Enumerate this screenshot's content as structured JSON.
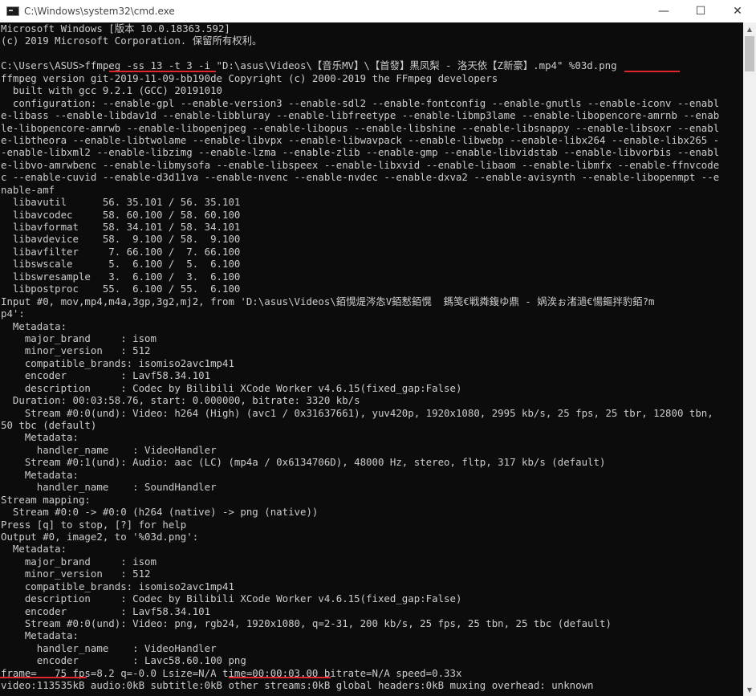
{
  "window": {
    "title": "C:\\Windows\\system32\\cmd.exe",
    "minimize": "—",
    "maximize": "☐",
    "close": "✕"
  },
  "console": {
    "lines": [
      "Microsoft Windows [版本 10.0.18363.592]",
      "(c) 2019 Microsoft Corporation. 保留所有权利。",
      "",
      "C:\\Users\\ASUS>ffmpeg -ss 13 -t 3 -i \"D:\\asus\\Videos\\【音乐MV】\\【首發】黑凤梨 - 洛天依【Z新豪】.mp4\" %03d.png",
      "ffmpeg version git-2019-11-09-bb190de Copyright (c) 2000-2019 the FFmpeg developers",
      "  built with gcc 9.2.1 (GCC) 20191010",
      "  configuration: --enable-gpl --enable-version3 --enable-sdl2 --enable-fontconfig --enable-gnutls --enable-iconv --enabl",
      "e-libass --enable-libdav1d --enable-libbluray --enable-libfreetype --enable-libmp3lame --enable-libopencore-amrnb --enab",
      "le-libopencore-amrwb --enable-libopenjpeg --enable-libopus --enable-libshine --enable-libsnappy --enable-libsoxr --enabl",
      "e-libtheora --enable-libtwolame --enable-libvpx --enable-libwavpack --enable-libwebp --enable-libx264 --enable-libx265 -",
      "-enable-libxml2 --enable-libzimg --enable-lzma --enable-zlib --enable-gmp --enable-libvidstab --enable-libvorbis --enabl",
      "e-libvo-amrwbenc --enable-libmysofa --enable-libspeex --enable-libxvid --enable-libaom --enable-libmfx --enable-ffnvcode",
      "c --enable-cuvid --enable-d3d11va --enable-nvenc --enable-nvdec --enable-dxva2 --enable-avisynth --enable-libopenmpt --e",
      "nable-amf",
      "  libavutil      56. 35.101 / 56. 35.101",
      "  libavcodec     58. 60.100 / 58. 60.100",
      "  libavformat    58. 34.101 / 58. 34.101",
      "  libavdevice    58.  9.100 / 58.  9.100",
      "  libavfilter     7. 66.100 /  7. 66.100",
      "  libswscale      5.  6.100 /  5.  6.100",
      "  libswresample   3.  6.100 /  3.  6.100",
      "  libpostproc    55.  6.100 / 55.  6.100",
      "Input #0, mov,mp4,m4a,3gp,3g2,mj2, from 'D:\\asus\\Videos\\銆愰煶涔怣V銆慭銆愰  鎷笺€戦粦鍑ゆ鼎 - 娲涘ぉ渚濄€愓鏂拌豹銆?m",
      "p4':",
      "  Metadata:",
      "    major_brand     : isom",
      "    minor_version   : 512",
      "    compatible_brands: isomiso2avc1mp41",
      "    encoder         : Lavf58.34.101",
      "    description     : Codec by Bilibili XCode Worker v4.6.15(fixed_gap:False)",
      "  Duration: 00:03:58.76, start: 0.000000, bitrate: 3320 kb/s",
      "    Stream #0:0(und): Video: h264 (High) (avc1 / 0x31637661), yuv420p, 1920x1080, 2995 kb/s, 25 fps, 25 tbr, 12800 tbn,",
      "50 tbc (default)",
      "    Metadata:",
      "      handler_name    : VideoHandler",
      "    Stream #0:1(und): Audio: aac (LC) (mp4a / 0x6134706D), 48000 Hz, stereo, fltp, 317 kb/s (default)",
      "    Metadata:",
      "      handler_name    : SoundHandler",
      "Stream mapping:",
      "  Stream #0:0 -> #0:0 (h264 (native) -> png (native))",
      "Press [q] to stop, [?] for help",
      "Output #0, image2, to '%03d.png':",
      "  Metadata:",
      "    major_brand     : isom",
      "    minor_version   : 512",
      "    compatible_brands: isomiso2avc1mp41",
      "    description     : Codec by Bilibili XCode Worker v4.6.15(fixed_gap:False)",
      "    encoder         : Lavf58.34.101",
      "    Stream #0:0(und): Video: png, rgb24, 1920x1080, q=2-31, 200 kb/s, 25 fps, 25 tbn, 25 tbc (default)",
      "    Metadata:",
      "      handler_name    : VideoHandler",
      "      encoder         : Lavc58.60.100 png",
      "frame=   75 fps=8.2 q=-0.0 Lsize=N/A time=00:00:03.00 bitrate=N/A speed=0.33x",
      "video:113535kB audio:0kB subtitle:0kB other streams:0kB global headers:0kB muxing overhead: unknown"
    ]
  },
  "colors": {
    "console_bg": "#0c0c0c",
    "console_text": "#cccccc",
    "underline_annotation": "#e0262b",
    "titlebar_bg": "#ffffff"
  },
  "icons": {
    "app": "cmd-icon",
    "scroll_up": "chevron-up-icon",
    "scroll_down": "chevron-down-icon"
  }
}
